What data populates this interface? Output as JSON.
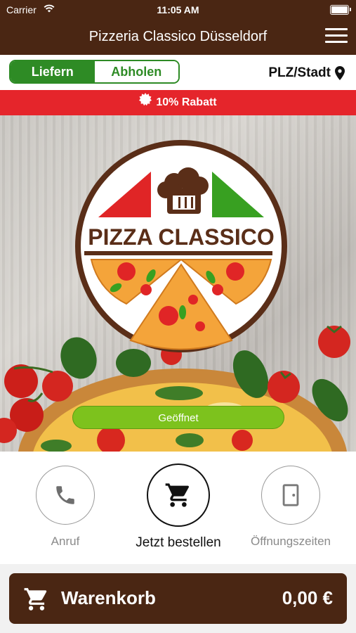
{
  "status_bar": {
    "carrier": "Carrier",
    "time": "11:05 AM"
  },
  "header": {
    "title": "Pizzeria Classico Düsseldorf"
  },
  "delivery_mode": {
    "deliver_label": "Liefern",
    "pickup_label": "Abholen",
    "selected": "Liefern"
  },
  "location": {
    "label": "PLZ/Stadt"
  },
  "promo": {
    "text": "10% Rabatt"
  },
  "hero": {
    "logo_text": "PIZZA CLASSICO",
    "status": "Geöffnet"
  },
  "actions": {
    "call_label": "Anruf",
    "order_label": "Jetzt bestellen",
    "hours_label": "Öffnungszeiten"
  },
  "cart": {
    "label": "Warenkorb",
    "total": "0,00 €"
  },
  "colors": {
    "brand_brown": "#4a2613",
    "green": "#2e8b25",
    "promo_red": "#e5252b",
    "open_green": "#7dc21d"
  }
}
